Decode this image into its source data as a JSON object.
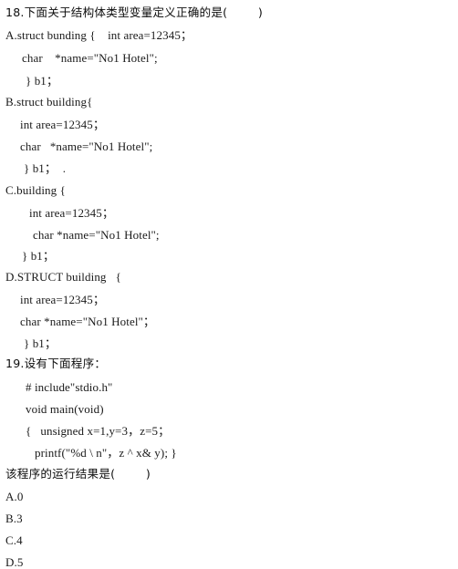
{
  "document": {
    "background_color": "#ffffff",
    "text_color": "#111111",
    "questions": [
      {
        "number": "18",
        "stem": "18.下面关于结构体类型变量定义正确的是(        )",
        "options": [
          {
            "label": "A",
            "lines": [
              "A.struct bunding {    int area=12345；",
              "char    *name=\"No1 Hotel\";",
              "} b1；"
            ]
          },
          {
            "label": "B",
            "lines": [
              "B.struct building{",
              "int area=12345；",
              "char   *name=\"No1 Hotel\";",
              "} b1；  ."
            ]
          },
          {
            "label": "C",
            "lines": [
              "C.building {",
              "int area=12345；",
              "char *name=\"No1 Hotel\";",
              "} b1；"
            ]
          },
          {
            "label": "D",
            "lines": [
              "D.STRUCT building   {",
              "int area=12345；",
              "char *name=\"No1 Hotel\"；",
              "} b1；"
            ]
          }
        ]
      },
      {
        "number": "19",
        "stem": "19.设有下面程序：",
        "code_lines": [
          "# include\"stdio.h\"",
          "void main(void)",
          "{   unsigned x=1,y=3，z=5；",
          "printf(\"%d \\ n\"，z ^ x& y); }"
        ],
        "prompt": "该程序的运行结果是(        )",
        "options": [
          {
            "label": "A",
            "text": "A.0"
          },
          {
            "label": "B",
            "text": "B.3"
          },
          {
            "label": "C",
            "text": "C.4"
          },
          {
            "label": "D",
            "text": "D.5"
          }
        ]
      }
    ]
  }
}
